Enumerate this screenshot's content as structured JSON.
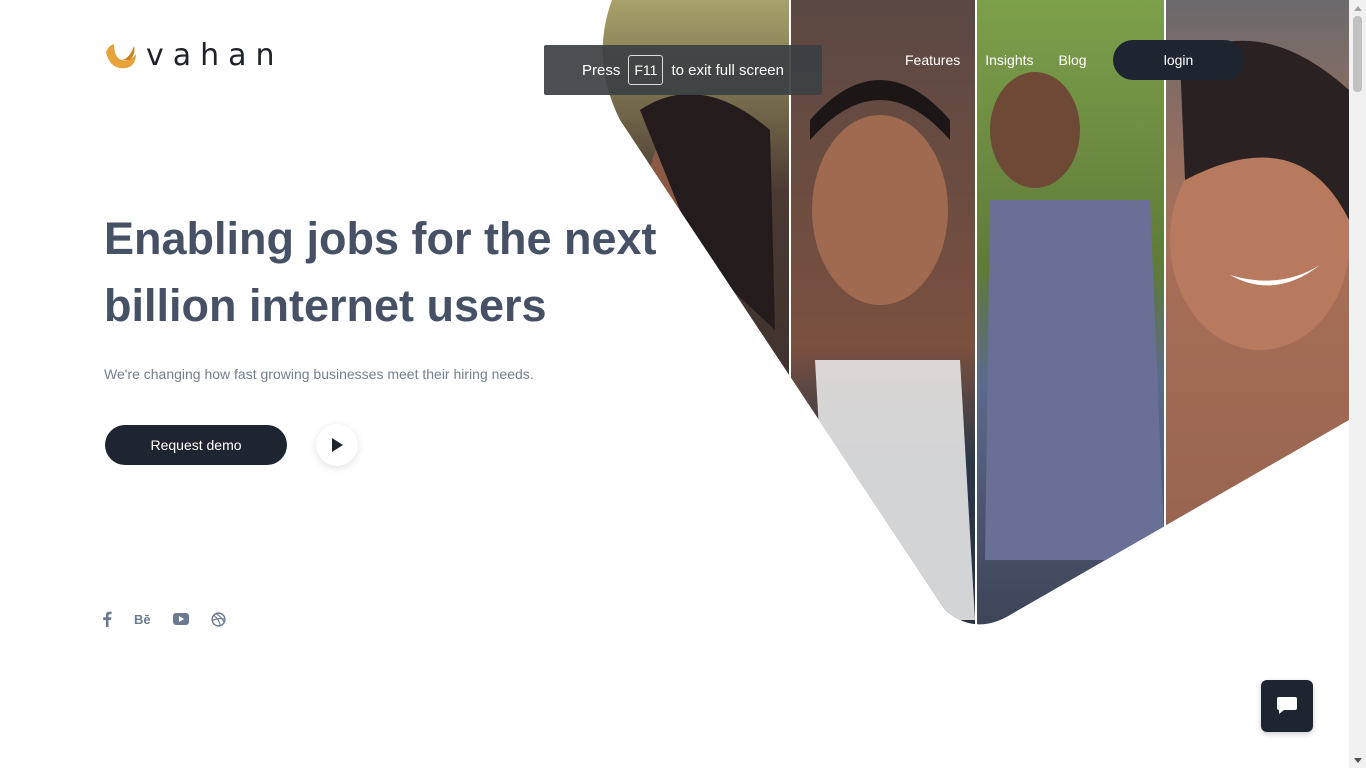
{
  "brand": {
    "name": "vahan",
    "accent": "#e8a23a"
  },
  "nav": {
    "links": [
      "Features",
      "Insights",
      "Blog"
    ],
    "login_label": "login"
  },
  "fullscreen_toast": {
    "prefix": "Press",
    "key": "F11",
    "suffix": "to exit full screen"
  },
  "hero": {
    "headline": "Enabling jobs for the next billion internet users",
    "subheadline": "We're changing how fast growing businesses meet their hiring needs.",
    "cta_label": "Request demo",
    "play_icon": "play-icon"
  },
  "social": [
    "facebook-icon",
    "behance-icon",
    "youtube-icon",
    "dribbble-icon"
  ],
  "social_behance_text": "Bē",
  "chat_icon": "chat-icon",
  "colors": {
    "dark": "#1e2430",
    "headline": "#475166",
    "muted": "#75808f"
  }
}
